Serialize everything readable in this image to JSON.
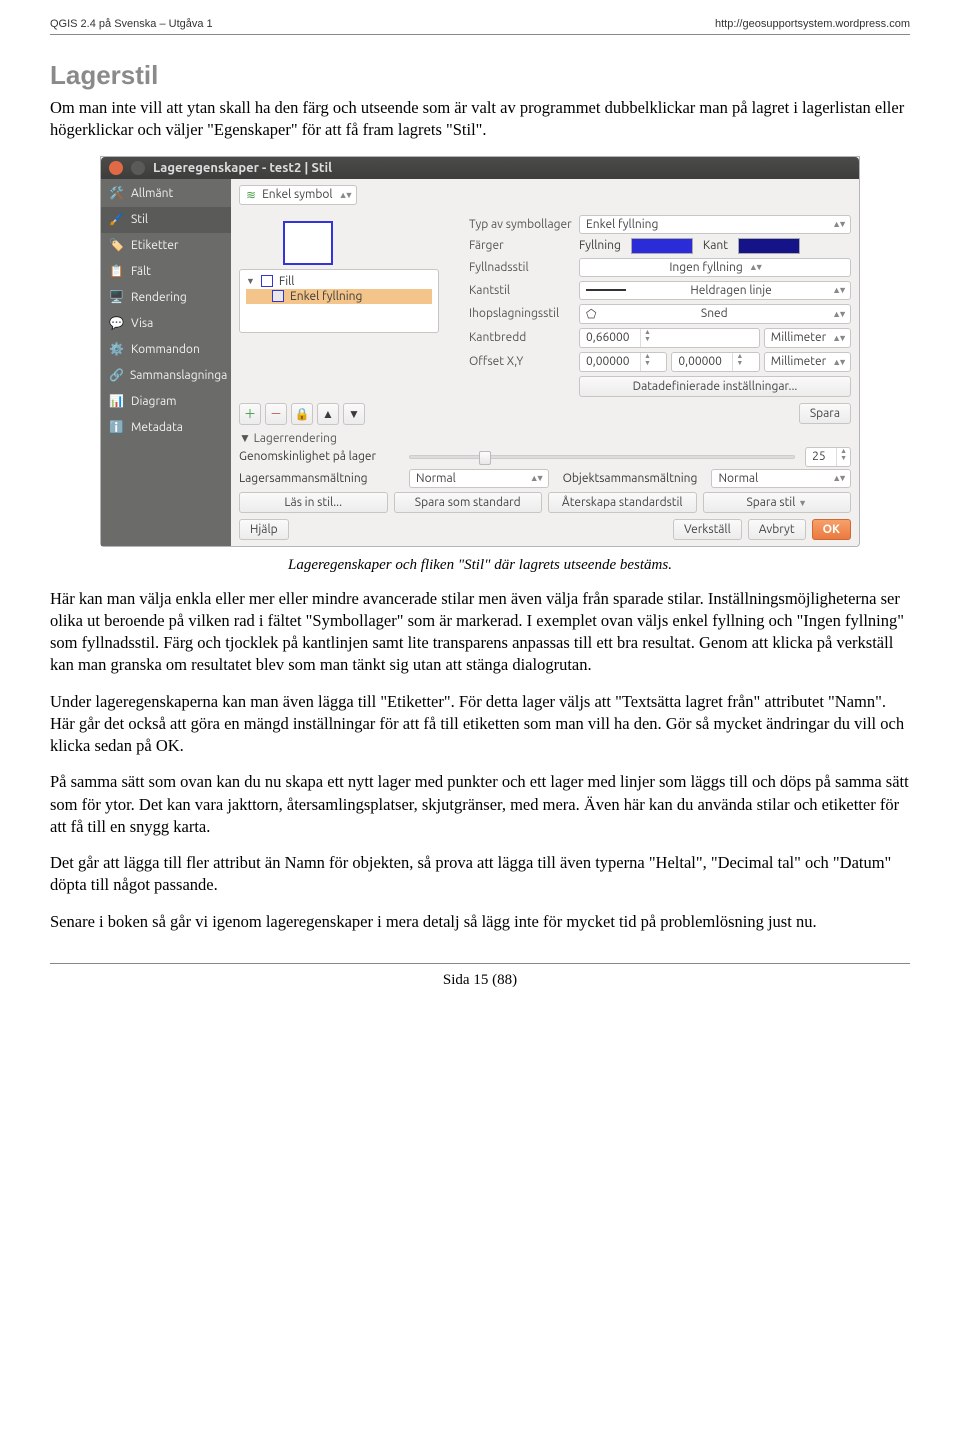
{
  "header": {
    "left": "QGIS 2.4 på Svenska – Utgåva 1",
    "right": "http://geosupportsystem.wordpress.com"
  },
  "section_title": "Lagerstil",
  "intro": "Om man inte vill att ytan skall ha den färg och utseende som är valt av programmet dubbelklickar man på lagret i lagerlistan eller högerklickar och väljer \"Egenskaper\" för att få fram lagrets \"Stil\".",
  "dialog": {
    "title": "Lageregenskaper - test2 | Stil",
    "side": {
      "items": [
        "Allmänt",
        "Stil",
        "Etiketter",
        "Fält",
        "Rendering",
        "Visa",
        "Kommandon",
        "Sammanslagninga",
        "Diagram",
        "Metadata"
      ]
    },
    "enkel_symbol": "Enkel symbol",
    "typ_label": "Typ av symbollager",
    "typ_value": "Enkel fyllning",
    "farger": "Färger",
    "fyllning": "Fyllning",
    "kant": "Kant",
    "fyllnadsstil": "Fyllnadsstil",
    "fyllnadsstil_v": "Ingen fyllning",
    "kantstil": "Kantstil",
    "kantstil_v": "Heldragen linje",
    "ihop": "Ihopslagningsstil",
    "ihop_v": "Sned",
    "kantbredd": "Kantbredd",
    "kantbredd_v": "0,66000",
    "mm": "Millimeter",
    "offset": "Offset X,Y",
    "offset_x": "0,00000",
    "offset_y": "0,00000",
    "datadef": "Datadefinierade inställningar...",
    "tree_fill": "Fill",
    "tree_enkel": "Enkel fyllning",
    "spara": "Spara",
    "lagerrendering": "Lagerrendering",
    "genomskin": "Genomskinlighet på lager",
    "genomskin_v": "25",
    "lagersamman": "Lagersammansmältning",
    "objektsamman": "Objektsammansmältning",
    "normal": "Normal",
    "las_in": "Läs in stil...",
    "spara_std": "Spara som standard",
    "aterskapa": "Återskapa standardstil",
    "spara_stil": "Spara stil",
    "hjalp": "Hjälp",
    "verkstall": "Verkställ",
    "avbryt": "Avbryt",
    "ok": "OK"
  },
  "caption": "Lageregenskaper och fliken \"Stil\" där lagrets utseende bestäms.",
  "para1": "Här kan man välja enkla eller mer eller mindre avancerade stilar men även välja från sparade stilar. Inställningsmöjligheterna ser olika ut beroende på vilken rad i fältet \"Symbollager\" som är markerad. I exemplet ovan väljs enkel fyllning och \"Ingen fyllning\" som fyllnadsstil. Färg och tjocklek på kantlinjen samt lite transparens anpassas till ett bra resultat. Genom att klicka på verkställ kan man granska om resultatet blev som man tänkt sig utan att stänga dialogrutan.",
  "para2": "Under lageregenskaperna kan man även lägga till \"Etiketter\". För detta lager väljs att \"Textsätta lagret från\" attributet \"Namn\". Här går det också att göra en mängd inställningar för att få till etiketten som man vill ha den. Gör så mycket ändringar du vill och klicka sedan på OK.",
  "para3": "På samma sätt som ovan kan du nu skapa ett nytt lager med punkter och ett lager med linjer som läggs till och döps på samma sätt som för ytor. Det kan vara jakttorn, återsamlingsplatser, skjutgränser, med mera. Även här kan du använda stilar och etiketter för att få till en snygg karta.",
  "para4": "Det går att lägga till fler attribut än Namn för objekten, så prova att lägga till även typerna \"Heltal\", \"Decimal tal\" och \"Datum\" döpta till något passande.",
  "para5": "Senare i boken så går vi igenom lageregenskaper i mera detalj så lägg inte för mycket tid på problemlösning just nu.",
  "page_footer": "Sida 15 (88)"
}
